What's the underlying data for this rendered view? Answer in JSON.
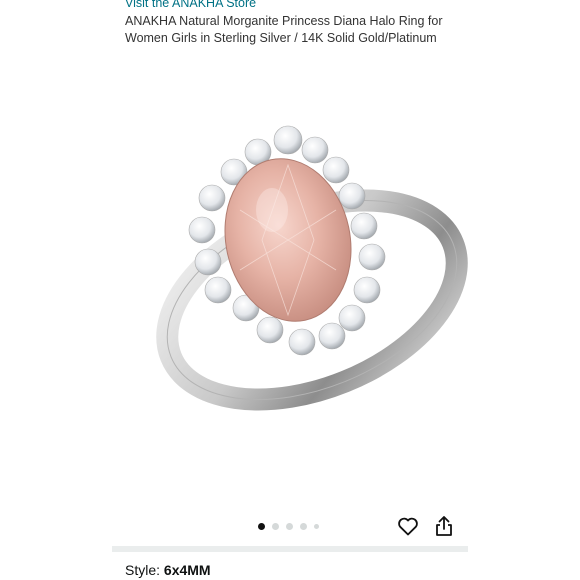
{
  "product": {
    "store_link": "Visit the ANAKHA Store",
    "title": "ANAKHA Natural Morganite Princess Diana Halo Ring for Women Girls in Sterling Silver / 14K Solid Gold/Platinum"
  },
  "image": {
    "description_icon": "ring-image",
    "gallery": {
      "current": 1,
      "total": 5
    }
  },
  "actions": {
    "heart_icon": "heart-icon",
    "share_icon": "share-icon"
  },
  "variation": {
    "label": "Style:",
    "value": "6x4MM"
  },
  "colors": {
    "link": "#007185",
    "text": "#333333",
    "stone": "#e8b9ad"
  }
}
